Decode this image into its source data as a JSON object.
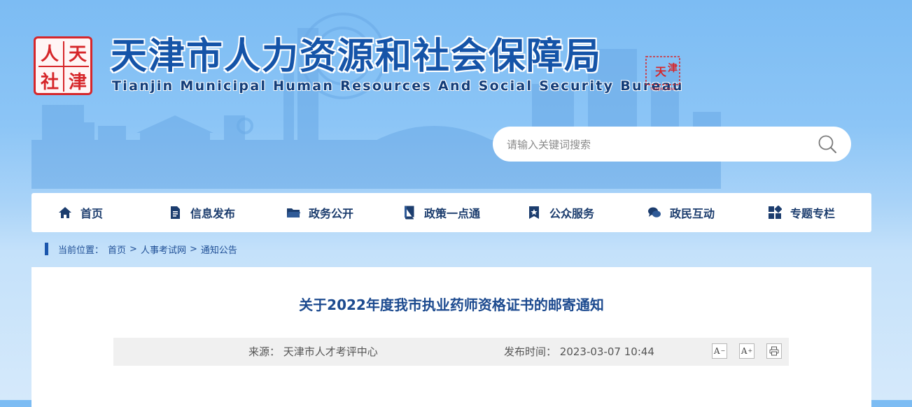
{
  "header": {
    "logo_chars": [
      "人",
      "天",
      "社",
      "津"
    ],
    "title": "天津市人力资源和社会保障局",
    "subtitle": "Tianjin Municipal Human Resources And Social Security Bureau",
    "city_seal_chars": [
      "天",
      "津"
    ],
    "city_seal_caption": "TIANJIN CHINA"
  },
  "search": {
    "placeholder": "请输入关键词搜索",
    "icon": "search-icon"
  },
  "nav": {
    "items": [
      {
        "label": "首页",
        "icon": "home-icon"
      },
      {
        "label": "信息发布",
        "icon": "document-icon"
      },
      {
        "label": "政务公开",
        "icon": "folder-icon"
      },
      {
        "label": "政策一点通",
        "icon": "book-icon"
      },
      {
        "label": "公众服务",
        "icon": "bookmark-star-icon"
      },
      {
        "label": "政民互动",
        "icon": "chat-icon"
      },
      {
        "label": "专题专栏",
        "icon": "grid-icon"
      }
    ]
  },
  "breadcrumb": {
    "prefix": "当前位置：",
    "items": [
      "首页",
      "人事考试网",
      "通知公告"
    ],
    "separator": ">"
  },
  "article": {
    "title": "关于2022年度我市执业药师资格证书的邮寄通知",
    "source_label": "来源：",
    "source": "天津市人才考评中心",
    "date_label": "发布时间：",
    "date": "2023-03-07 10:44",
    "tools": {
      "font_smaller": "A",
      "font_smaller_mark": "−",
      "font_larger": "A",
      "font_larger_mark": "+",
      "print_icon": "print-icon"
    }
  },
  "colors": {
    "brand_blue": "#1554a8",
    "seal_red": "#d6262a",
    "nav_text": "#1c3d6e"
  }
}
